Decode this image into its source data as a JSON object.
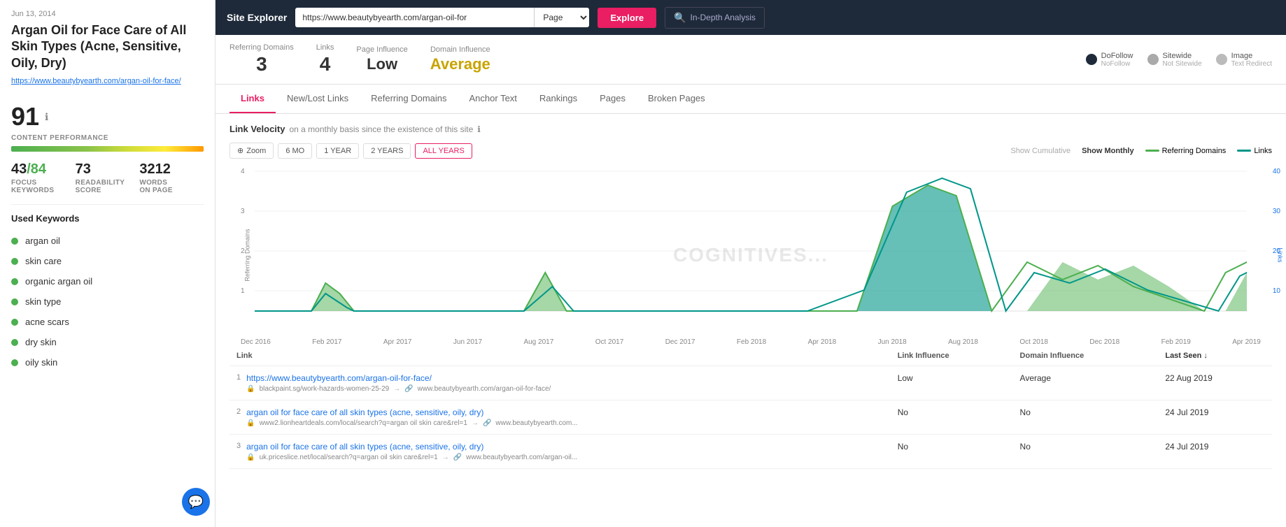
{
  "topNav": {
    "siteExplorer": "Site Explorer",
    "url": "https://www.beautybyearth.com/argan-oil-for",
    "pageMode": "Page",
    "exploreBtn": "Explore",
    "inDepthBtn": "In-Depth Analysis"
  },
  "metrics": {
    "referringDomains": {
      "label": "Referring Domains",
      "value": "3"
    },
    "links": {
      "label": "Links",
      "value": "4"
    },
    "pageInfluence": {
      "label": "Page Influence",
      "value": "Low"
    },
    "domainInfluence": {
      "label": "Domain Influence",
      "value": "Average"
    },
    "legends": [
      {
        "label": "DoFollow",
        "sub": "NoFollow",
        "type": "dofollow"
      },
      {
        "label": "Sitewide",
        "sub": "Not Sitewide",
        "type": "sitewide"
      },
      {
        "label": "Image",
        "sub": "Text Redirect",
        "type": "image"
      }
    ]
  },
  "tabs": [
    {
      "label": "Links",
      "active": true
    },
    {
      "label": "New/Lost Links",
      "active": false
    },
    {
      "label": "Referring Domains",
      "active": false
    },
    {
      "label": "Anchor Text",
      "active": false
    },
    {
      "label": "Rankings",
      "active": false
    },
    {
      "label": "Pages",
      "active": false
    },
    {
      "label": "Broken Pages",
      "active": false
    }
  ],
  "chart": {
    "title": "Link Velocity",
    "subtitle": "on a monthly basis since the existence of this site",
    "showCumulative": "Show Cumulative",
    "showMonthly": "Show Monthly",
    "legendReferring": "Referring Domains",
    "legendLinks": "Links",
    "zoomLabel": "Zoom",
    "periods": [
      "6 MO",
      "1 YEAR",
      "2 YEARS",
      "ALL YEARS"
    ],
    "activePeriod": "ALL YEARS",
    "yAxisLeft": [
      "4",
      "3",
      "2",
      "1"
    ],
    "yAxisRight": [
      "40",
      "30",
      "20",
      "10"
    ],
    "xAxisLabels": [
      "Dec 2016",
      "Feb 2017",
      "Apr 2017",
      "Jun 2017",
      "Aug 2017",
      "Oct 2017",
      "Dec 2017",
      "Feb 2018",
      "Apr 2018",
      "Jun 2018",
      "Aug 2018",
      "Oct 2018",
      "Dec 2018",
      "Feb 2019",
      "Apr 2019"
    ],
    "watermark": "COGNITIVES..."
  },
  "sidebar": {
    "date": "Jun 13, 2014",
    "title": "Argan Oil for Face Care of All Skin Types (Acne, Sensitive, Oily, Dry)",
    "url": "https://www.beautybyearth.com/argan-oil-for-face/",
    "score": "91",
    "contentPerf": "CONTENT PERFORMANCE",
    "stats": [
      {
        "value": "43",
        "slash": "/84",
        "label1": "FOCUS",
        "label2": "KEYWORDS"
      },
      {
        "value": "73",
        "label1": "READABILITY",
        "label2": "SCORE"
      },
      {
        "value": "3212",
        "label1": "WORDS",
        "label2": "ON PAGE"
      }
    ],
    "usedKeywordsTitle": "Used Keywords",
    "keywords": [
      "argan oil",
      "skin care",
      "organic argan oil",
      "skin type",
      "acne scars",
      "dry skin",
      "oily skin"
    ]
  },
  "table": {
    "headers": [
      {
        "label": "Link",
        "sortable": false
      },
      {
        "label": "Link Influence",
        "sortable": false
      },
      {
        "label": "Domain Influence",
        "sortable": false
      },
      {
        "label": "Last Seen ↓",
        "sortable": true
      }
    ],
    "rows": [
      {
        "num": "1",
        "link": "https://www.beautybyearth.com/argan-oil-for-face/",
        "subFrom": "blackpaint.sg/work-hazards-women-25-29",
        "subTo": "www.beautybyearth.com/argan-oil-for-face/",
        "linkInfluence": "Low",
        "domainInfluence": "Average",
        "lastSeen": "22 Aug 2019"
      },
      {
        "num": "2",
        "link": "argan oil for face care of all skin types (acne, sensitive, oily, dry)",
        "subFrom": "www2.lionheartdeals.com/local/search?q=argan oil skin care&rel=1",
        "subTo": "www.beautybyearth.com...",
        "linkInfluence": "No",
        "domainInfluence": "No",
        "lastSeen": "24 Jul 2019"
      },
      {
        "num": "3",
        "link": "argan oil for face care of all skin types (acne, sensitive, oily, dry)",
        "subFrom": "uk.priceslice.net/local/search?q=argan oil skin care&rel=1",
        "subTo": "www.beautybyearth.com/argan-oil...",
        "linkInfluence": "No",
        "domainInfluence": "No",
        "lastSeen": "24 Jul 2019"
      }
    ]
  }
}
